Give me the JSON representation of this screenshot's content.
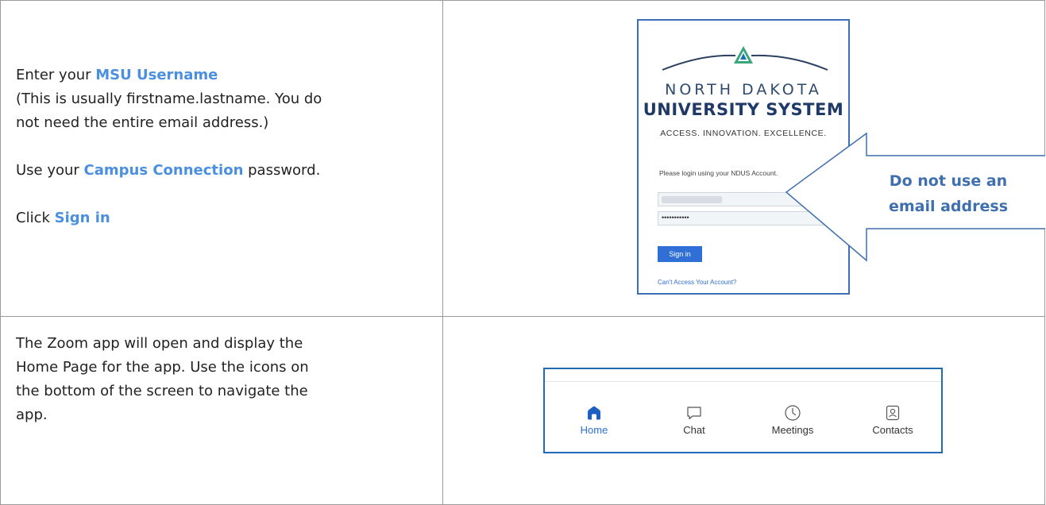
{
  "row1": {
    "line1_prefix": "Enter your ",
    "line1_highlight": "MSU Username",
    "line2": "(This is usually firstname.lastname. You do",
    "line3": "not need the entire email address.)",
    "line4_prefix": "Use your ",
    "line4_highlight": "Campus Connection",
    "line4_suffix": " password.",
    "line5_prefix": "Click ",
    "line5_highlight": "Sign in"
  },
  "login_screen": {
    "logo_word1": "NORTH DAKOTA",
    "logo_word2": "UNIVERSITY SYSTEM",
    "motto": "ACCESS. INNOVATION. EXCELLENCE.",
    "prompt": "Please login using your NDUS Account.",
    "password_mask": "•••••••••••",
    "signin_label": "Sign in",
    "cant_access": "Can't Access Your Account?"
  },
  "callout": {
    "line1": "Do not use an",
    "line2": "email address"
  },
  "row2": {
    "line1": "The Zoom app will open and display the",
    "line2": "Home Page for the app. Use the icons on",
    "line3": "the bottom of the screen to navigate the",
    "line4": "app."
  },
  "zoom_nav": {
    "items": [
      {
        "label": "Home",
        "icon": "home-icon",
        "active": true
      },
      {
        "label": "Chat",
        "icon": "chat-icon",
        "active": false
      },
      {
        "label": "Meetings",
        "icon": "clock-icon",
        "active": false
      },
      {
        "label": "Contacts",
        "icon": "contact-card-icon",
        "active": false
      }
    ],
    "accent_color": "#2d6fd6"
  },
  "colors": {
    "highlight": "#4a8fe0",
    "callout_text": "#3f6fae",
    "frame": "#3c6fb4"
  }
}
